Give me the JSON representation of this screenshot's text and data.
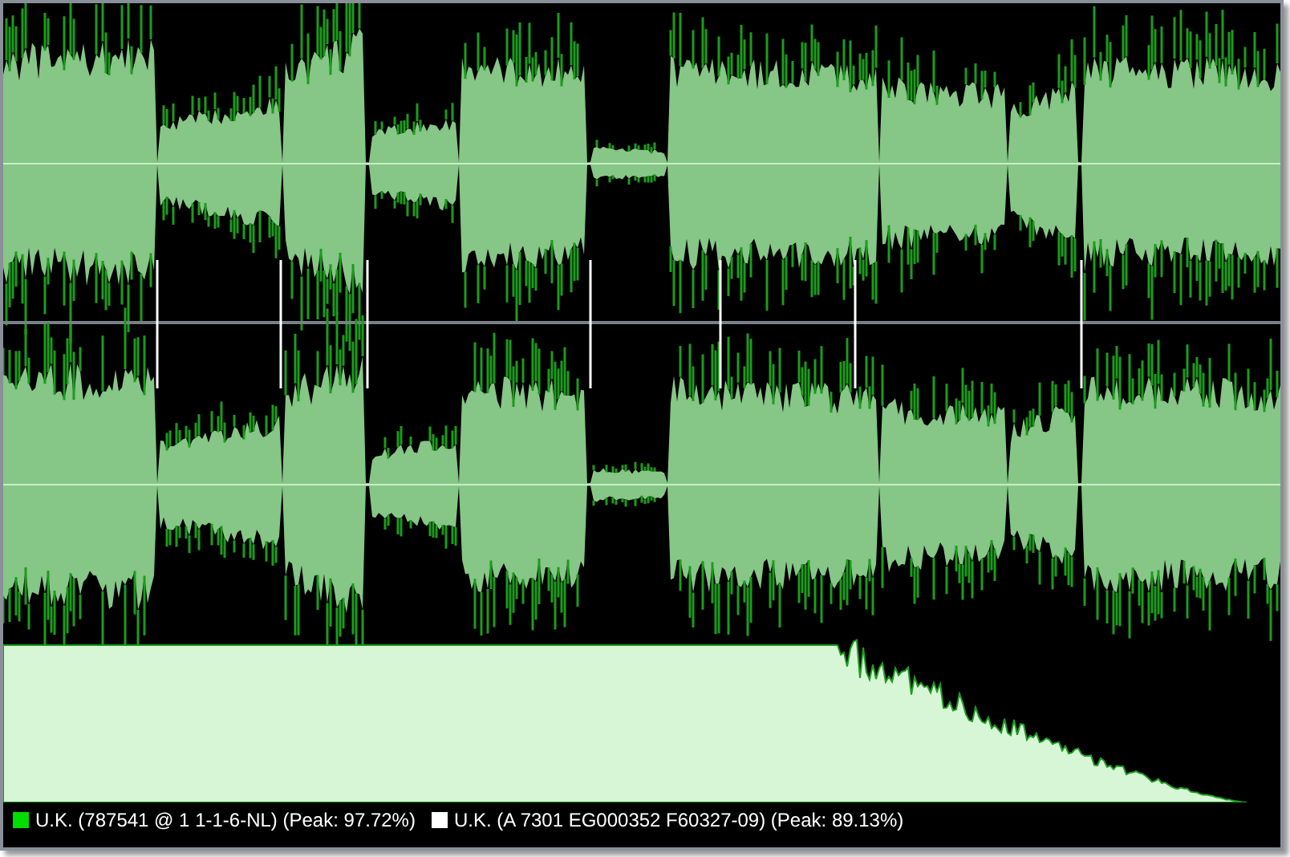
{
  "legend": [
    {
      "text": "U.K. (787541 @ 1 1-1-6-NL) (Peak: 97.72%)",
      "color": "#00dd00"
    },
    {
      "text": "U.K. (A 7301 EG000352 F60327-09) (Peak: 89.13%)",
      "color": "#ffffff"
    }
  ]
}
